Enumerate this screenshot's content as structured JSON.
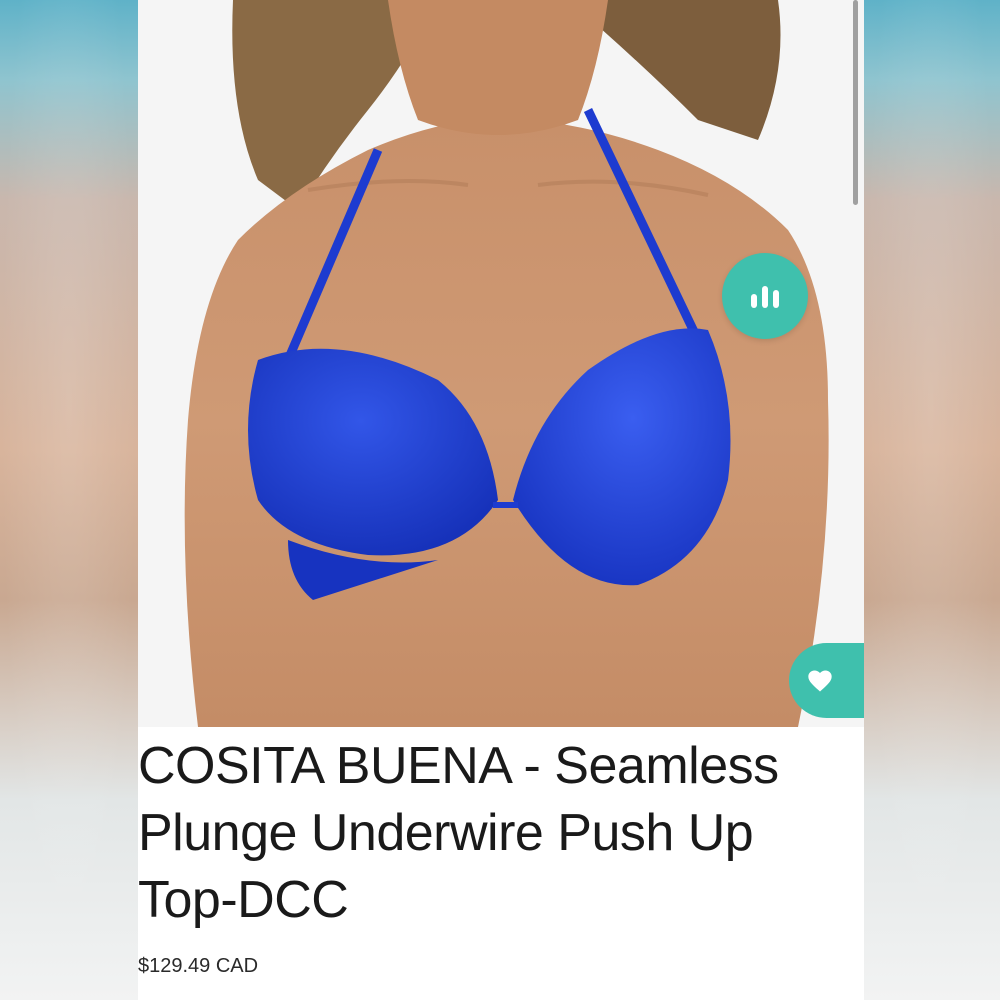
{
  "product": {
    "title": "COSITA BUENA - Seamless Plunge Underwire Push Up Top-DCC",
    "price": "$129.49 CAD",
    "image_icon": "product-photo-bikini-top"
  },
  "actions": {
    "insights_icon": "bar-chart-icon",
    "like_icon": "heart-icon"
  },
  "colors": {
    "accent": "#3fc0ad",
    "fabric": "#1f3fd0",
    "text": "#1a1a1a"
  }
}
